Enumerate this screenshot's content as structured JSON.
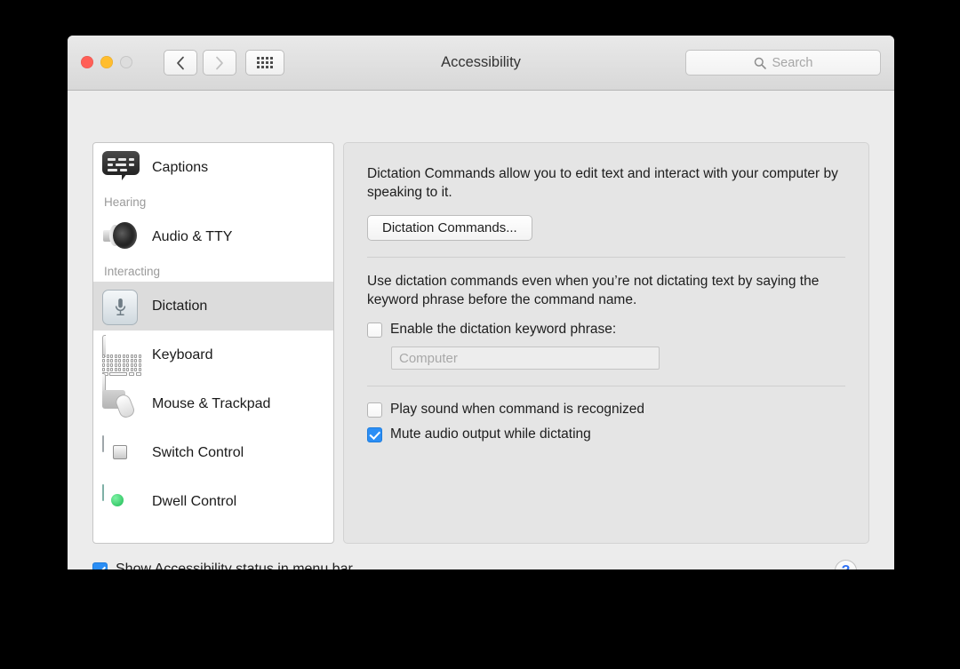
{
  "window": {
    "title": "Accessibility",
    "traffic_lights": [
      "close",
      "minimize",
      "zoom"
    ],
    "nav": {
      "back": "back-arrow",
      "forward": "forward-arrow",
      "grid": "show-all-grid"
    },
    "search": {
      "placeholder": "Search",
      "icon": "search-icon"
    }
  },
  "sidebar": {
    "items": [
      {
        "type": "item",
        "label": "Captions",
        "icon": "captions-icon",
        "selected": false
      },
      {
        "type": "group",
        "label": "Hearing"
      },
      {
        "type": "item",
        "label": "Audio & TTY",
        "icon": "speaker-icon",
        "selected": false
      },
      {
        "type": "group",
        "label": "Interacting"
      },
      {
        "type": "item",
        "label": "Dictation",
        "icon": "microphone-icon",
        "selected": true
      },
      {
        "type": "item",
        "label": "Keyboard",
        "icon": "keyboard-icon",
        "selected": false
      },
      {
        "type": "item",
        "label": "Mouse & Trackpad",
        "icon": "mouse-trackpad-icon",
        "selected": false
      },
      {
        "type": "item",
        "label": "Switch Control",
        "icon": "switch-control-icon",
        "selected": false
      },
      {
        "type": "item",
        "label": "Dwell Control",
        "icon": "dwell-control-icon",
        "selected": false
      }
    ]
  },
  "panel": {
    "intro_text": "Dictation Commands allow you to edit text and interact with your computer by speaking to it.",
    "commands_button": "Dictation Commands...",
    "keyword_text": "Use dictation commands even when you’re not dictating text by saying the keyword phrase before the command name.",
    "enable_keyword": {
      "label": "Enable the dictation keyword phrase:",
      "checked": false
    },
    "keyword_input": {
      "placeholder": "Computer",
      "value": ""
    },
    "play_sound": {
      "label": "Play sound when command is recognized",
      "checked": false
    },
    "mute_audio": {
      "label": "Mute audio output while dictating",
      "checked": true
    }
  },
  "footer": {
    "show_status": {
      "label": "Show Accessibility status in menu bar",
      "checked": true
    },
    "help": {
      "glyph": "?",
      "name": "help-button"
    }
  },
  "colors": {
    "accent_checkbox": "#2b8ef5",
    "help_blue": "#2b6ff5",
    "close_red": "#ff5f57",
    "minimize_yellow": "#ffbd2e",
    "zoom_gray": "#dddddd",
    "selection_gray": "#dcdcdc",
    "dwell_dot_green": "#1dba54"
  }
}
